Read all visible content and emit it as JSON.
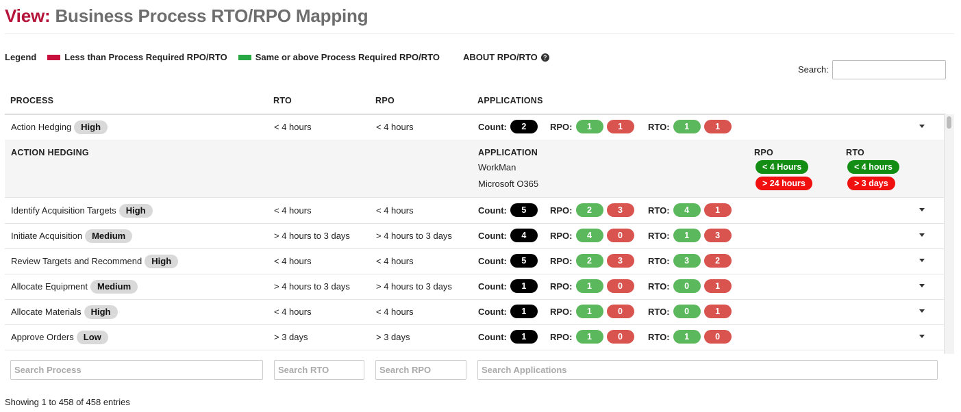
{
  "header": {
    "view_label": "View:",
    "title": "Business Process RTO/RPO Mapping"
  },
  "legend": {
    "label": "Legend",
    "items": [
      {
        "label": "Less than Process Required RPO/RTO",
        "color": "#c8103c"
      },
      {
        "label": "Same or above Process Required RPO/RTO",
        "color": "#28a745"
      }
    ],
    "about_label": "ABOUT RPO/RTO",
    "about_icon": "question-circle-icon"
  },
  "search": {
    "label": "Search:",
    "value": ""
  },
  "columns": {
    "process": "PROCESS",
    "rto": "RTO",
    "rpo": "RPO",
    "applications": "APPLICATIONS"
  },
  "labels": {
    "count": "Count:",
    "rpo": "RPO:",
    "rto": "RTO:"
  },
  "rows": [
    {
      "process": "Action Hedging",
      "criticality": "High",
      "rto": "< 4 hours",
      "rpo": "< 4 hours",
      "count": "2",
      "rpo_green": "1",
      "rpo_red": "1",
      "rto_green": "1",
      "rto_red": "1"
    },
    {
      "process": "Identify Acquisition Targets",
      "criticality": "High",
      "rto": "< 4 hours",
      "rpo": "< 4 hours",
      "count": "5",
      "rpo_green": "2",
      "rpo_red": "3",
      "rto_green": "4",
      "rto_red": "1"
    },
    {
      "process": "Initiate Acquisition",
      "criticality": "Medium",
      "rto": "> 4 hours to 3 days",
      "rpo": "> 4 hours to 3 days",
      "count": "4",
      "rpo_green": "4",
      "rpo_red": "0",
      "rto_green": "1",
      "rto_red": "3"
    },
    {
      "process": "Review Targets and Recommend",
      "criticality": "High",
      "rto": "< 4 hours",
      "rpo": "< 4 hours",
      "count": "5",
      "rpo_green": "2",
      "rpo_red": "3",
      "rto_green": "3",
      "rto_red": "2"
    },
    {
      "process": "Allocate Equipment",
      "criticality": "Medium",
      "rto": "> 4 hours to 3 days",
      "rpo": "> 4 hours to 3 days",
      "count": "1",
      "rpo_green": "1",
      "rpo_red": "0",
      "rto_green": "0",
      "rto_red": "1"
    },
    {
      "process": "Allocate Materials",
      "criticality": "High",
      "rto": "< 4 hours",
      "rpo": "< 4 hours",
      "count": "1",
      "rpo_green": "1",
      "rpo_red": "0",
      "rto_green": "0",
      "rto_red": "1"
    },
    {
      "process": "Approve Orders",
      "criticality": "Low",
      "rto": "> 3 days",
      "rpo": "> 3 days",
      "count": "1",
      "rpo_green": "1",
      "rpo_red": "0",
      "rto_green": "1",
      "rto_red": "0"
    }
  ],
  "detail": {
    "process_heading": "ACTION HEDGING",
    "app_heading": "APPLICATION",
    "rpo_heading": "RPO",
    "rto_heading": "RTO",
    "apps": [
      {
        "name": "WorkMan",
        "rpo": "< 4 Hours",
        "rto": "< 4 hours"
      },
      {
        "name": "Microsoft O365",
        "rpo": "> 24 hours",
        "rto": "> 3 days"
      }
    ]
  },
  "filters": {
    "process_placeholder": "Search Process",
    "rto_placeholder": "Search RTO",
    "rpo_placeholder": "Search RPO",
    "applications_placeholder": "Search Applications"
  },
  "info": "Showing 1 to 458 of 458 entries",
  "colors": {
    "accent": "#b5153b",
    "green_pill": "#5cb85c",
    "red_pill": "#d9534f",
    "detail_green": "#138d13",
    "detail_red": "#f01010"
  }
}
